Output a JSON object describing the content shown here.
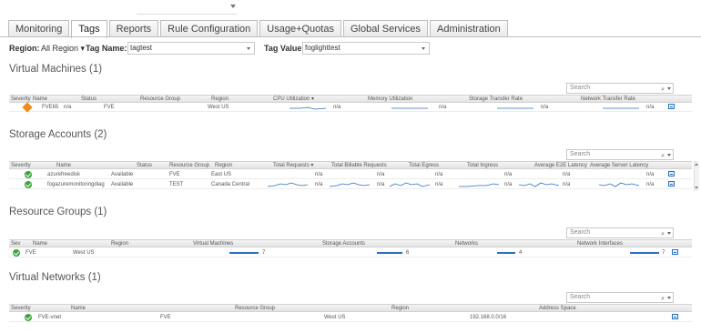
{
  "tabs": [
    "Monitoring",
    "Tags",
    "Reports",
    "Rule Configuration",
    "Usage+Quotas",
    "Global Services",
    "Administration"
  ],
  "filters": {
    "region_label": "Region:",
    "region_value": "All Region",
    "tag_name_label": "Tag Name:",
    "tag_name_value": "tagtest",
    "tag_value_label": "Tag Value:",
    "tag_value_value": "foglighttest"
  },
  "search_placeholder": "Search",
  "na": "n/a",
  "vm": {
    "title": "Virtual Machines (1)",
    "headers": [
      "Severity",
      "Name",
      "Status",
      "Resource Group",
      "Region",
      "CPU Utilization ▾",
      "Memory Utilization",
      "Storage Transfer Rate",
      "Network Transfer Rate"
    ],
    "rows": [
      {
        "name": "FVE65",
        "status": "n/a",
        "group": "FVE",
        "region": "West US"
      }
    ]
  },
  "sa": {
    "title": "Storage Accounts (2)",
    "headers": [
      "Severity",
      "Name",
      "Status",
      "Resource Group",
      "Region",
      "Total Requests ▾",
      "Total Billable Requests",
      "Total Egress",
      "Total Ingress",
      "Average E2E Latency",
      "Average Server Latency"
    ],
    "rows": [
      {
        "name": "azurefreedisk",
        "status": "Available",
        "group": "FVE",
        "region": "East US"
      },
      {
        "name": "fogazuremonitoringdiag",
        "status": "Available",
        "group": "TEST",
        "region": "Canada Central"
      }
    ]
  },
  "rg": {
    "title": "Resource Groups (1)",
    "headers": [
      "Sev",
      "Name",
      "Region",
      "Virtual Machines",
      "Storage Accounts",
      "Networks",
      "Network Interfaces"
    ],
    "rows": [
      {
        "name": "FVE",
        "region": "West US",
        "vms": "7",
        "storage": "6",
        "networks": "4",
        "nics": "7"
      }
    ]
  },
  "vn": {
    "title": "Virtual Networks (1)",
    "headers": [
      "Severity",
      "Name",
      "Resource Group",
      "Region",
      "Address Space"
    ],
    "rows": [
      {
        "name": "FVE-vnet",
        "group": "FVE",
        "region": "West US",
        "address": "192.168.0.0/16"
      }
    ]
  },
  "colors": {
    "ok": "#3aa53a",
    "warning": "#f08c1e",
    "accent": "#2a6fbf"
  }
}
